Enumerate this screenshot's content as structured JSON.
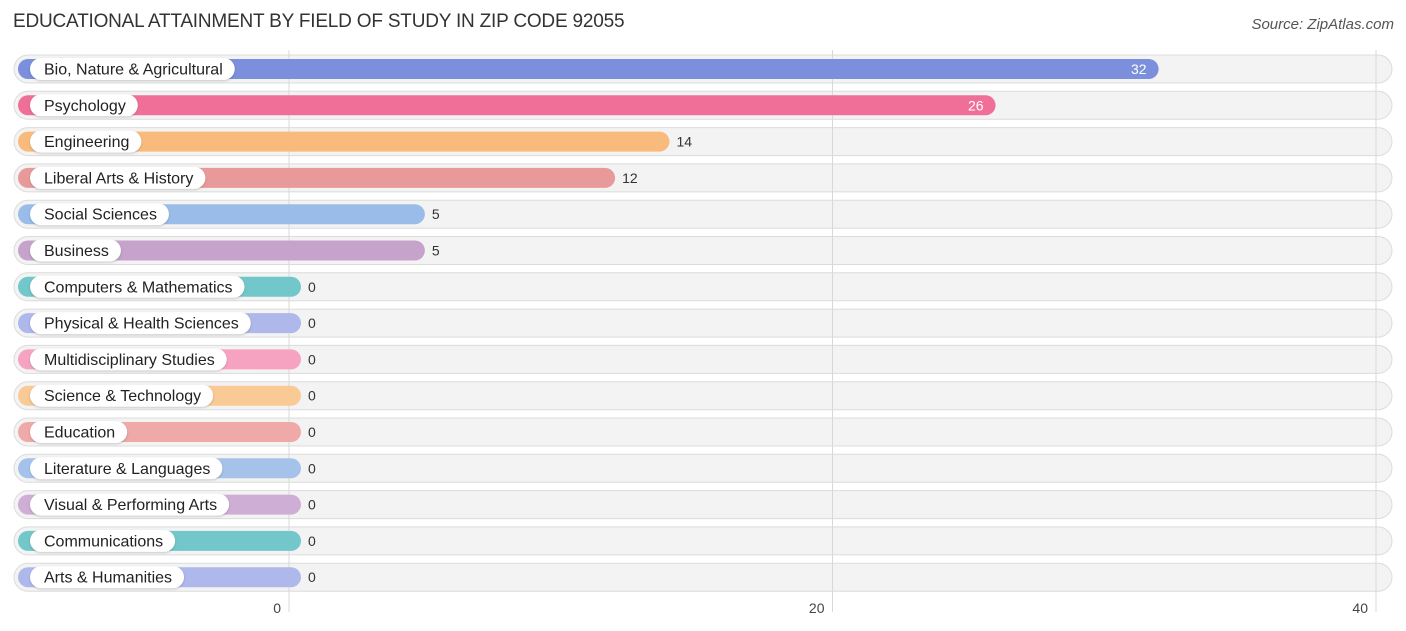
{
  "title": "EDUCATIONAL ATTAINMENT BY FIELD OF STUDY IN ZIP CODE 92055",
  "source": "Source: ZipAtlas.com",
  "chart_data": {
    "type": "bar",
    "orientation": "horizontal",
    "title": "EDUCATIONAL ATTAINMENT BY FIELD OF STUDY IN ZIP CODE 92055",
    "xlabel": "",
    "ylabel": "",
    "xlim": [
      0,
      40
    ],
    "xticks": [
      0,
      20,
      40
    ],
    "xtick_labels": [
      "0",
      "20",
      "40"
    ],
    "grid": true,
    "categories": [
      "Bio, Nature & Agricultural",
      "Psychology",
      "Engineering",
      "Liberal Arts & History",
      "Social Sciences",
      "Business",
      "Computers & Mathematics",
      "Physical & Health Sciences",
      "Multidisciplinary Studies",
      "Science & Technology",
      "Education",
      "Literature & Languages",
      "Visual & Performing Arts",
      "Communications",
      "Arts & Humanities"
    ],
    "values": [
      32,
      26,
      14,
      12,
      5,
      5,
      0,
      0,
      0,
      0,
      0,
      0,
      0,
      0,
      0
    ],
    "colors": [
      "#7b8fdc",
      "#f06f98",
      "#f9bb7c",
      "#e79a99",
      "#99bde8",
      "#c5a3cb",
      "#72c7ca",
      "#aeb8ea",
      "#f5a3c0",
      "#f9c996",
      "#eea9a8",
      "#a5c3ea",
      "#cfaed5",
      "#72c7ca",
      "#aeb8ea"
    ]
  }
}
